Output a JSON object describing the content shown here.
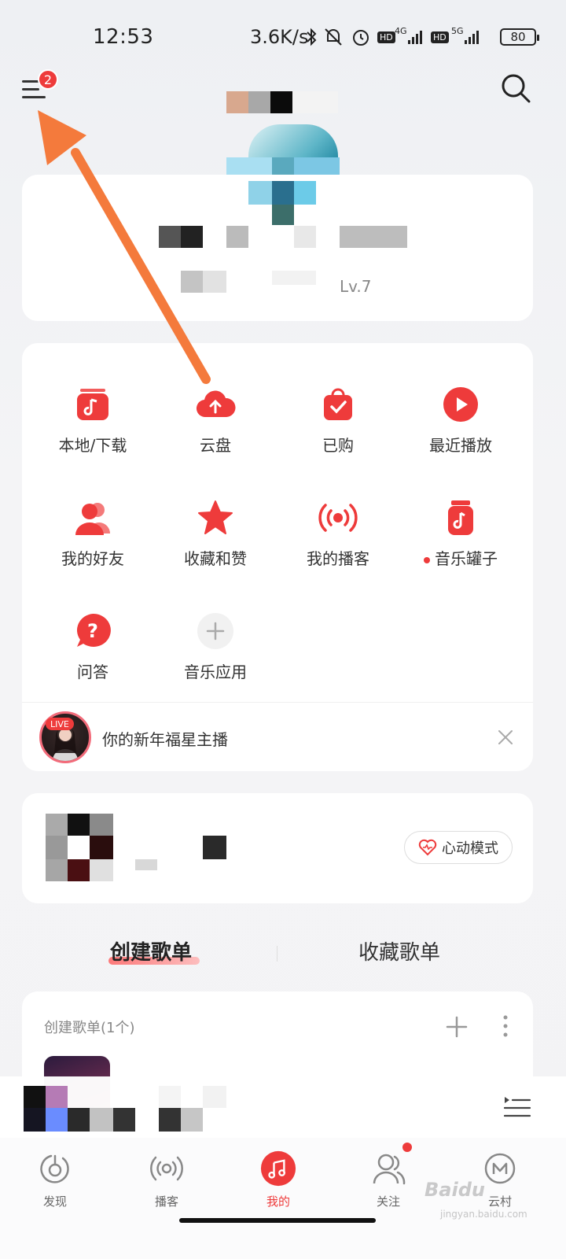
{
  "status_bar": {
    "time": "12:53",
    "net_speed": "3.6K/s",
    "network_1": "4G",
    "network_2": "5G",
    "hd_label": "HD",
    "battery": "80"
  },
  "header": {
    "menu_badge": "2"
  },
  "profile": {
    "level": "Lv.7"
  },
  "grid": {
    "items": [
      {
        "label": "本地/下载"
      },
      {
        "label": "云盘"
      },
      {
        "label": "已购"
      },
      {
        "label": "最近播放"
      },
      {
        "label": "我的好友"
      },
      {
        "label": "收藏和赞"
      },
      {
        "label": "我的播客"
      },
      {
        "label": "音乐罐子"
      },
      {
        "label": "问答"
      },
      {
        "label": "音乐应用"
      }
    ]
  },
  "live_banner": {
    "tag": "LIVE",
    "text": "你的新年福星主播"
  },
  "heart_mode": {
    "label": "心动模式"
  },
  "playlist_tabs": {
    "created": "创建歌单",
    "collected": "收藏歌单"
  },
  "playlist_section": {
    "header": "创建歌单(1个)"
  },
  "bottom_nav": {
    "items": [
      {
        "label": "发现"
      },
      {
        "label": "播客"
      },
      {
        "label": "我的"
      },
      {
        "label": "关注"
      },
      {
        "label": "云村"
      }
    ]
  },
  "watermark": {
    "brand": "Baidu",
    "sub": "jingyan.baidu.com"
  },
  "colors": {
    "accent": "#ee3b3b",
    "arrow": "#f47a3c"
  }
}
